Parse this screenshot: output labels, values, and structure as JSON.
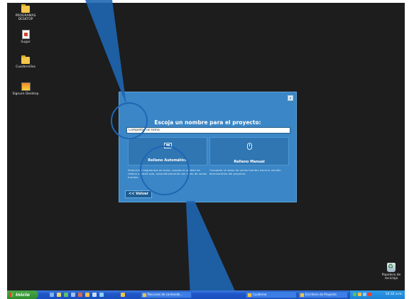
{
  "desktop": {
    "icons": [
      {
        "label": "PROGRAMAS DESKTOP",
        "icon": "folder-icon"
      },
      {
        "label": "Sugar",
        "icon": "document-icon"
      },
      {
        "label": "Cuadernillos",
        "icon": "folder-icon"
      },
      {
        "label": "Signum Desktop",
        "icon": "app-icon"
      }
    ],
    "recycle_bin": {
      "label": "Papelera de reciclaje",
      "icon": "recycle-bin-icon"
    }
  },
  "dialog": {
    "title": "Escoja un nombre para el proyecto:",
    "name_input_value": "Completar un tema",
    "close_label": "x",
    "modes": [
      {
        "label": "Relleno Automático",
        "icon": "grid-icon",
        "description": "Seleccione segmentos de texto, usando la utilidad de relleno o usted solo, automáticamente con texto de varias fuentes."
      },
      {
        "label": "Relleno Manual",
        "icon": "mouse-icon",
        "description": "Complete un texto de varias fuentes hacia la versión demostrativa del proyecto."
      }
    ],
    "back_label": "<< Volver"
  },
  "taskbar": {
    "start_label": "Inicio",
    "tasks": [
      {
        "label": "Recursos de contenido..."
      },
      {
        "label": "Cuaderno"
      },
      {
        "label": "Escritorio de Proyecto"
      }
    ],
    "clock": "10:32 a.m."
  },
  "colors": {
    "dialog_bg": "#3a86c6",
    "desktop_bg": "#1d1d1d",
    "taskbar": "#1f56c8",
    "callout": "#1f66b3"
  }
}
